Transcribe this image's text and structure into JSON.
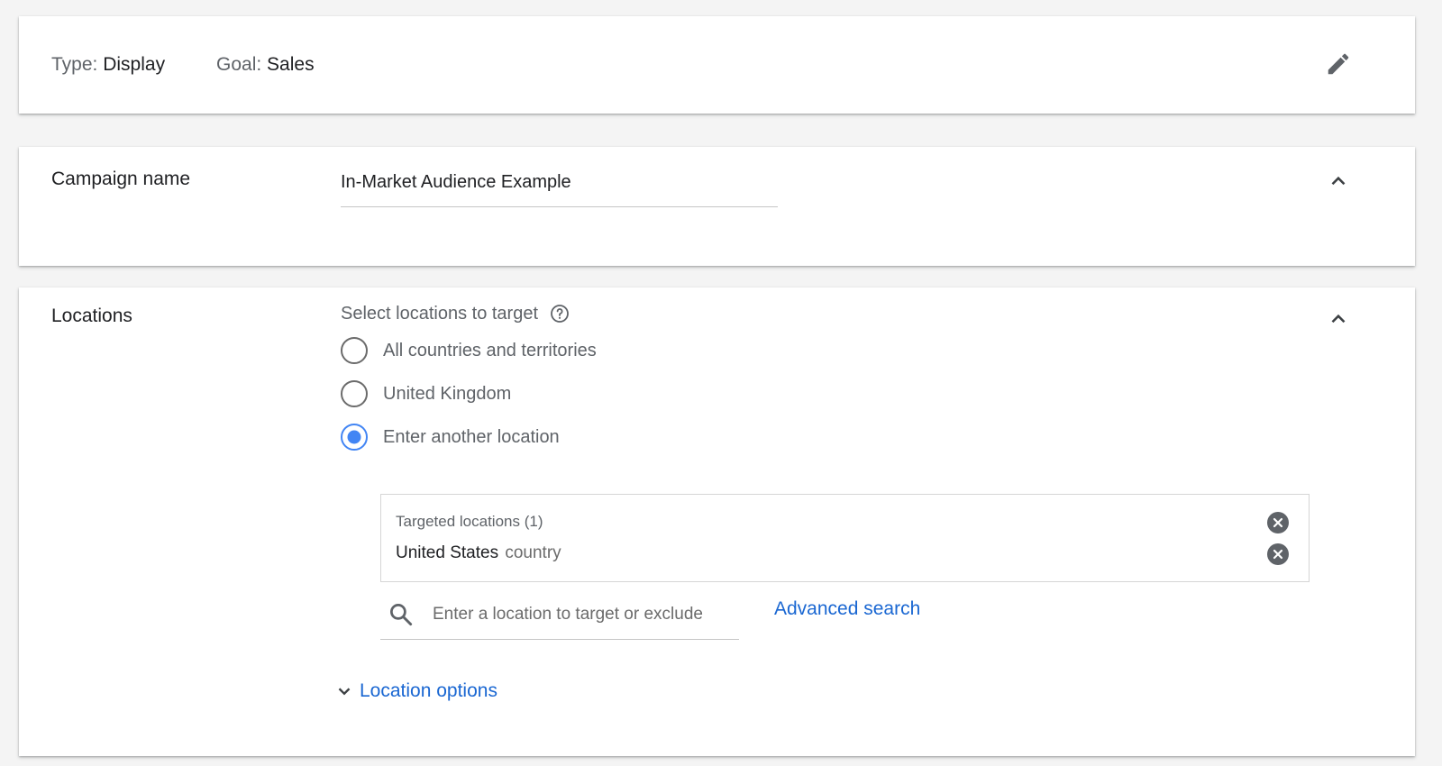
{
  "summary": {
    "type_label": "Type:",
    "type_value": "Display",
    "goal_label": "Goal:",
    "goal_value": "Sales",
    "edit_icon": "pencil-icon"
  },
  "campaign_name": {
    "label": "Campaign name",
    "value": "In-Market Audience Example",
    "collapse_icon": "chevron-up-icon"
  },
  "locations": {
    "label": "Locations",
    "prompt": "Select locations to target",
    "help_icon": "help-icon",
    "collapse_icon": "chevron-up-icon",
    "options": [
      {
        "label": "All countries and territories",
        "selected": false
      },
      {
        "label": "United Kingdom",
        "selected": false
      },
      {
        "label": "Enter another location",
        "selected": true
      }
    ],
    "targeted": {
      "header": "Targeted locations (1)",
      "items": [
        {
          "name": "United States",
          "type": "country"
        }
      ]
    },
    "search": {
      "placeholder": "Enter a location to target or exclude",
      "value": ""
    },
    "advanced_search": "Advanced search",
    "location_options": "Location options"
  },
  "colors": {
    "accent": "#4285f4",
    "link": "#1a67d2",
    "background": "#f4f4f4",
    "icon_grey": "#5f6368"
  }
}
